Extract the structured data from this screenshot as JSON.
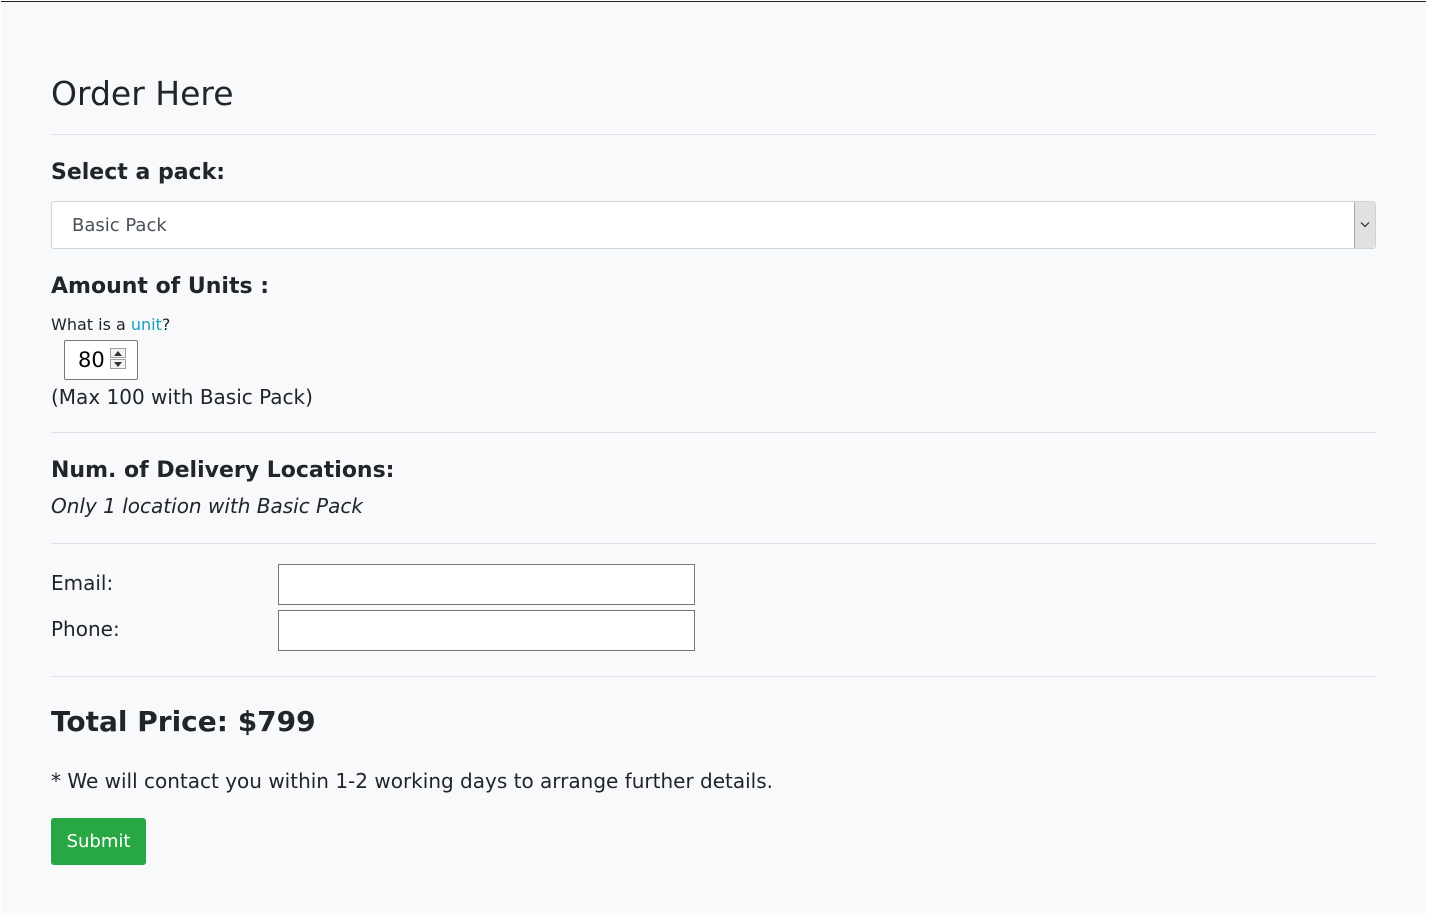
{
  "title": "Order Here",
  "pack": {
    "label": "Select a pack:",
    "selected": "Basic Pack"
  },
  "units": {
    "label": "Amount of Units :",
    "help_prefix": "What is a ",
    "help_link": "unit",
    "help_suffix": "?",
    "value": "80",
    "max_note": "(Max 100 with Basic Pack)"
  },
  "delivery": {
    "label": "Num. of Delivery Locations:",
    "note": "Only 1 location with Basic Pack"
  },
  "contact": {
    "email_label": "Email:",
    "email_value": "",
    "phone_label": "Phone:",
    "phone_value": ""
  },
  "total": {
    "text": "Total Price: $799"
  },
  "footer_note": "* We will contact you within 1-2 working days to arrange further details.",
  "submit_label": "Submit",
  "colors": {
    "background": "#f8f9fa",
    "link": "#17a2b8",
    "submit": "#28a745"
  },
  "icons": {
    "select_arrow": "chevron-down-icon",
    "spin_up": "caret-up-icon",
    "spin_down": "caret-down-icon"
  }
}
